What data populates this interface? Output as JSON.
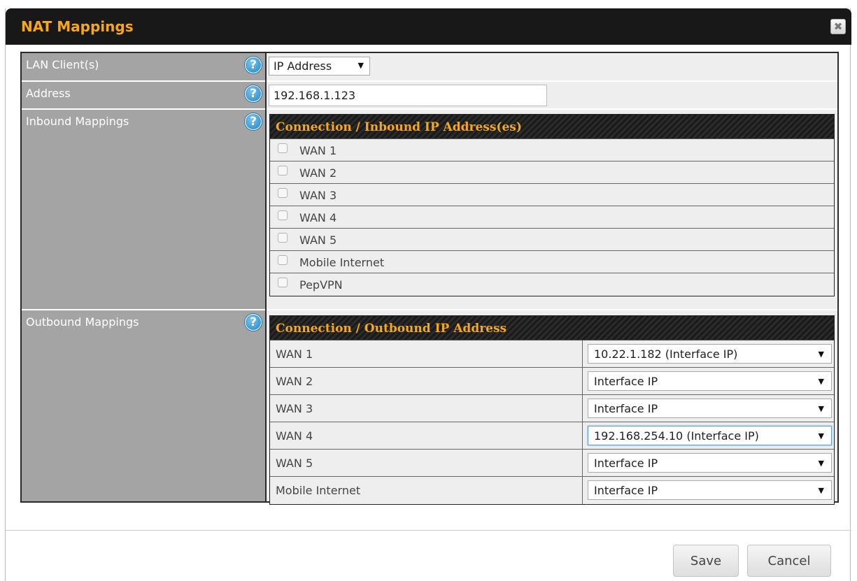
{
  "dialog": {
    "title": "NAT Mappings",
    "close_icon": "close-icon"
  },
  "fields": {
    "lan_client": {
      "label": "LAN Client(s)",
      "value": "IP Address"
    },
    "address": {
      "label": "Address",
      "value": "192.168.1.123"
    },
    "inbound": {
      "label": "Inbound Mappings"
    },
    "outbound": {
      "label": "Outbound Mappings"
    }
  },
  "inbound_table": {
    "header": "Connection / Inbound IP Address(es)",
    "rows": [
      {
        "label": "WAN 1",
        "checked": false
      },
      {
        "label": "WAN 2",
        "checked": false
      },
      {
        "label": "WAN 3",
        "checked": false
      },
      {
        "label": "WAN 4",
        "checked": false
      },
      {
        "label": "WAN 5",
        "checked": false
      },
      {
        "label": "Mobile Internet",
        "checked": false
      },
      {
        "label": "PepVPN",
        "checked": false
      }
    ]
  },
  "outbound_table": {
    "header": "Connection / Outbound IP Address",
    "rows": [
      {
        "connection": "WAN 1",
        "value": "10.22.1.182 (Interface IP)"
      },
      {
        "connection": "WAN 2",
        "value": "Interface IP"
      },
      {
        "connection": "WAN 3",
        "value": "Interface IP"
      },
      {
        "connection": "WAN 4",
        "value": "192.168.254.10 (Interface IP)"
      },
      {
        "connection": "WAN 5",
        "value": "Interface IP"
      },
      {
        "connection": "Mobile Internet",
        "value": "Interface IP"
      }
    ]
  },
  "help_glyph": "?",
  "caret_glyph": "▼",
  "buttons": {
    "save": "Save",
    "cancel": "Cancel"
  },
  "colors": {
    "title": "#f6a81a",
    "label_bg": "#a4a4a4",
    "help": "#1f86c9"
  }
}
